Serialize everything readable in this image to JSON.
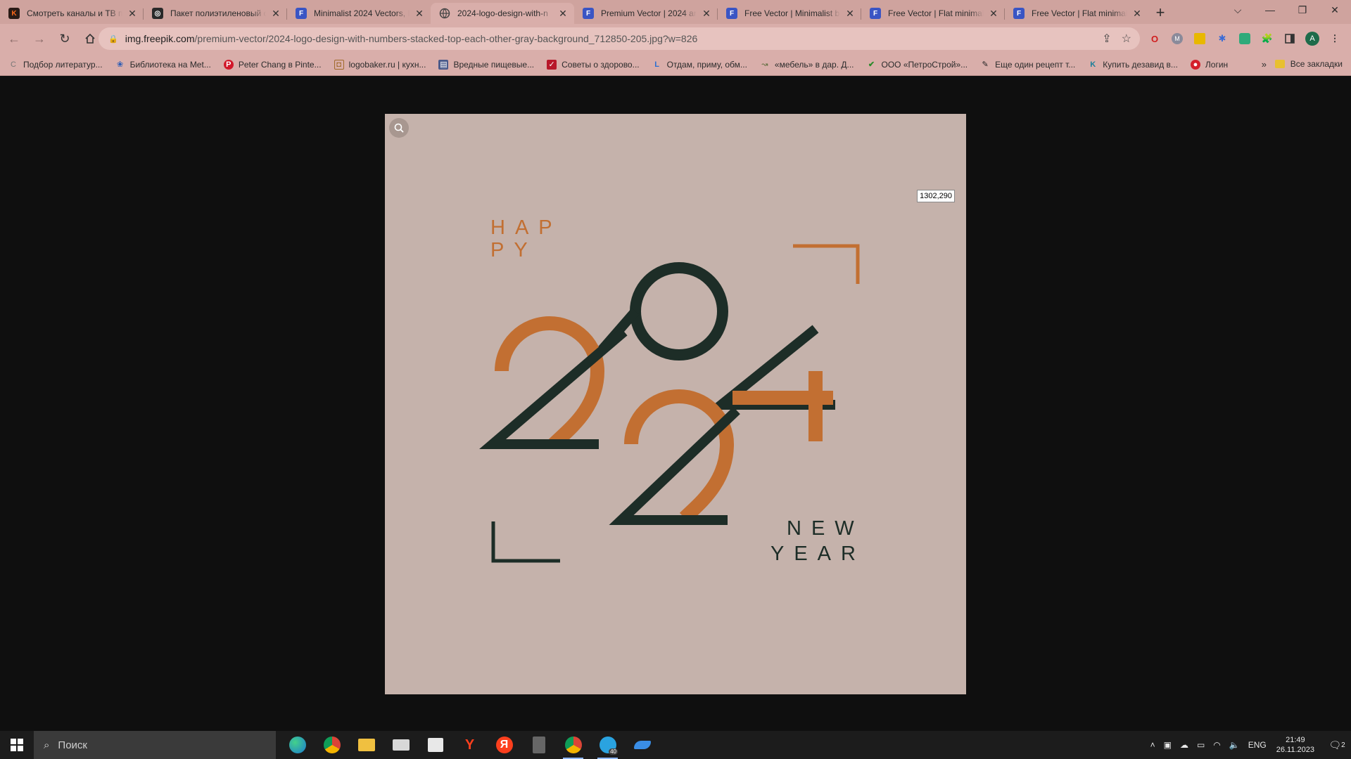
{
  "browser": {
    "tabs": [
      {
        "title": "Смотреть каналы и ТВ пр",
        "favicon": "kinopoisk-icon"
      },
      {
        "title": "Пакет полиэтиленовый с",
        "favicon": "package-site-icon"
      },
      {
        "title": "Minimalist 2024 Vectors, I",
        "favicon": "freepik-icon"
      },
      {
        "title": "2024-logo-design-with-n",
        "favicon": "web-icon",
        "active": true
      },
      {
        "title": "Premium Vector | 2024 an",
        "favicon": "freepik-icon"
      },
      {
        "title": "Free Vector | Minimalist b",
        "favicon": "freepik-icon"
      },
      {
        "title": "Free Vector | Flat minimal",
        "favicon": "freepik-icon"
      },
      {
        "title": "Free Vector | Flat minimal",
        "favicon": "freepik-icon"
      }
    ],
    "new_tab": "+",
    "url_host": "img.freepik.com",
    "url_path": "/premium-vector/2024-logo-design-with-numbers-stacked-top-each-other-gray-background_712850-205.jpg?w=826",
    "profile_initial": "A",
    "bookmarks": [
      {
        "label": "Подбор литератур...",
        "icon": "bookmark-c-icon"
      },
      {
        "label": "Библиотека на Met...",
        "icon": "bookmark-library-icon"
      },
      {
        "label": "Peter Chang в Pinte...",
        "icon": "pinterest-icon"
      },
      {
        "label": "logobaker.ru | кухн...",
        "icon": "bookmark-logobaker-icon"
      },
      {
        "label": "Вредные пищевые...",
        "icon": "bookmark-doc-icon"
      },
      {
        "label": "Советы о здорово...",
        "icon": "bookmark-check-icon"
      },
      {
        "label": "Отдам, приму, обм...",
        "icon": "bookmark-l-icon"
      },
      {
        "label": "«мебель» в дар. Д...",
        "icon": "bookmark-gift-icon"
      },
      {
        "label": "ООО «ПетроСтрой»...",
        "icon": "bookmark-tick-icon"
      },
      {
        "label": "Еще один рецепт т...",
        "icon": "bookmark-recipe-icon"
      },
      {
        "label": "Купить дезавид в...",
        "icon": "bookmark-k-icon"
      },
      {
        "label": "Логин",
        "icon": "bookmark-login-icon"
      }
    ],
    "bookmarks_more": "»",
    "all_bookmarks": "Все закладки"
  },
  "viewer": {
    "coord_label": "1302,290",
    "artwork": {
      "happy_line1": "HAP",
      "happy_line2": "PY",
      "new_line": "NEW",
      "year_line": "YEAR",
      "colors": {
        "background": "#c5b2ab",
        "orange": "#c26f32",
        "dark_green": "#1d2d27"
      }
    }
  },
  "taskbar": {
    "search_placeholder": "Поиск",
    "language": "ENG",
    "time": "21:49",
    "date": "26.11.2023",
    "notifications": "2",
    "telegram_badge": "40"
  }
}
